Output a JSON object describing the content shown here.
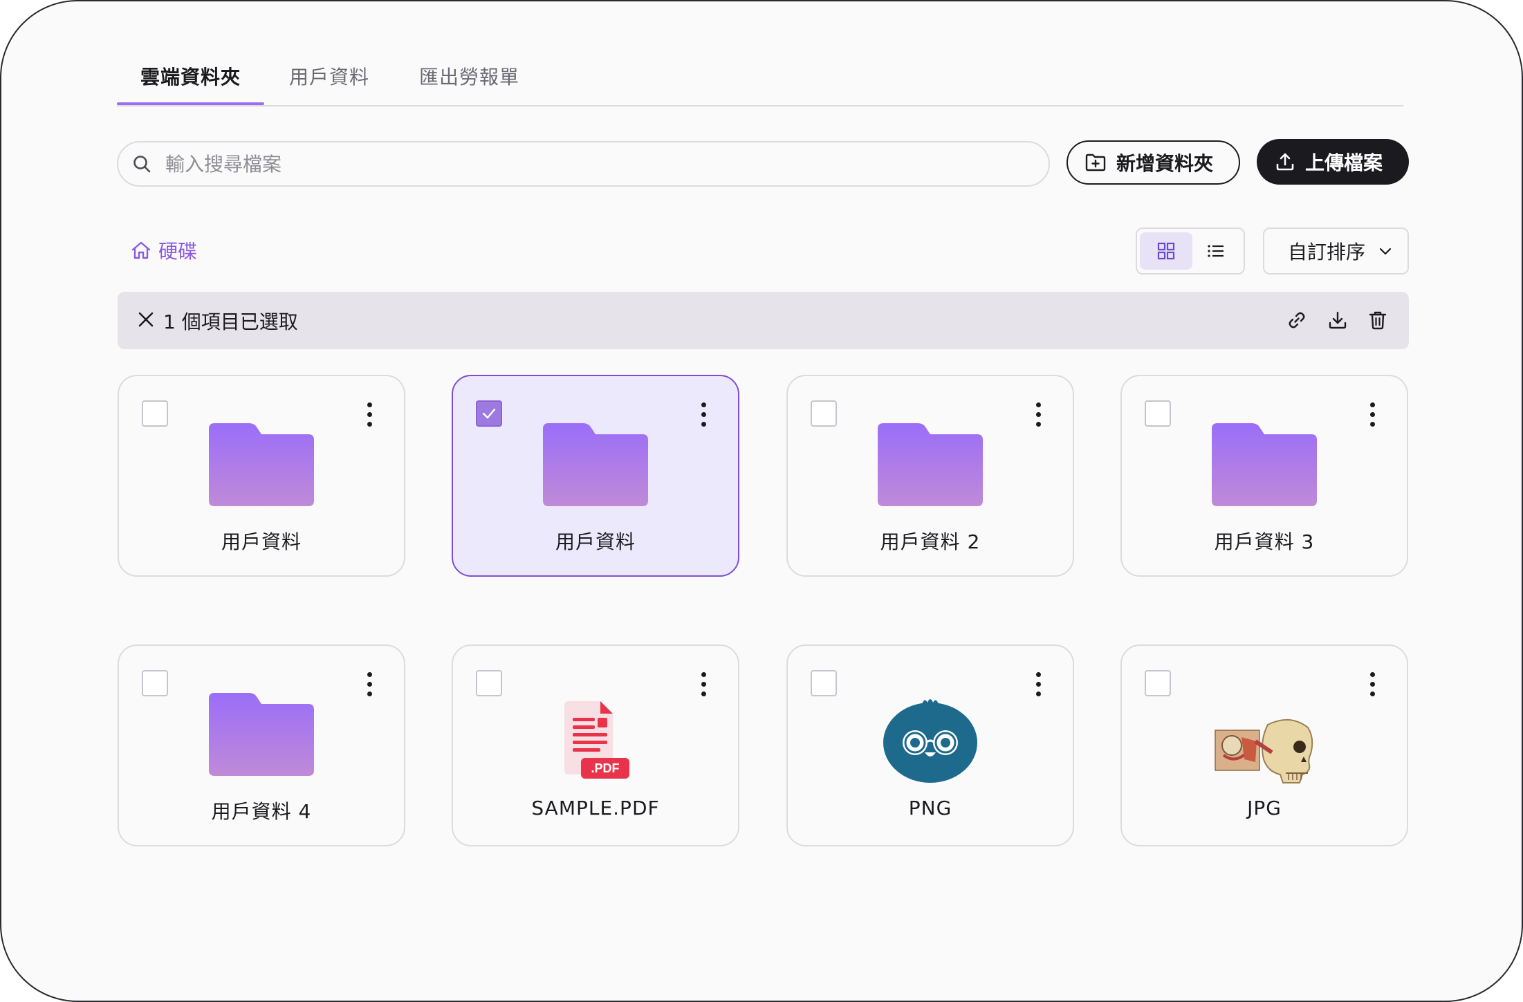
{
  "tabs": [
    {
      "label": "雲端資料夾",
      "active": true
    },
    {
      "label": "用戶資料",
      "active": false
    },
    {
      "label": "匯出勞報單",
      "active": false
    }
  ],
  "search": {
    "placeholder": "輸入搜尋檔案",
    "value": ""
  },
  "toolbar": {
    "new_folder_label": "新增資料夾",
    "upload_label": "上傳檔案"
  },
  "breadcrumb": {
    "root_label": "硬碟",
    "icon": "home-icon"
  },
  "view": {
    "mode": "grid",
    "grid_icon": "grid-icon",
    "list_icon": "list-icon"
  },
  "sort": {
    "label": "自訂排序",
    "icon": "chevron-down-icon"
  },
  "selection": {
    "text": "1 個項目已選取",
    "count": 1,
    "actions": [
      "link-icon",
      "download-icon",
      "trash-icon"
    ]
  },
  "items": [
    {
      "name": "用戶資料",
      "type": "folder",
      "selected": false
    },
    {
      "name": "用戶資料",
      "type": "folder",
      "selected": true
    },
    {
      "name": "用戶資料 2",
      "type": "folder",
      "selected": false
    },
    {
      "name": "用戶資料 3",
      "type": "folder",
      "selected": false
    },
    {
      "name": "用戶資料 4",
      "type": "folder",
      "selected": false
    },
    {
      "name": "SAMPLE.PDF",
      "type": "pdf",
      "selected": false,
      "badge": ".PDF"
    },
    {
      "name": "PNG",
      "type": "png",
      "selected": false
    },
    {
      "name": "JPG",
      "type": "jpg",
      "selected": false
    }
  ],
  "colors": {
    "accent": "#9a6ef0",
    "folder_top": "#9a6ef8",
    "folder_bottom": "#c08ad8",
    "dark_button": "#1b1b1f",
    "pdf_red": "#e8334a",
    "png_blue": "#1d6a8c"
  }
}
